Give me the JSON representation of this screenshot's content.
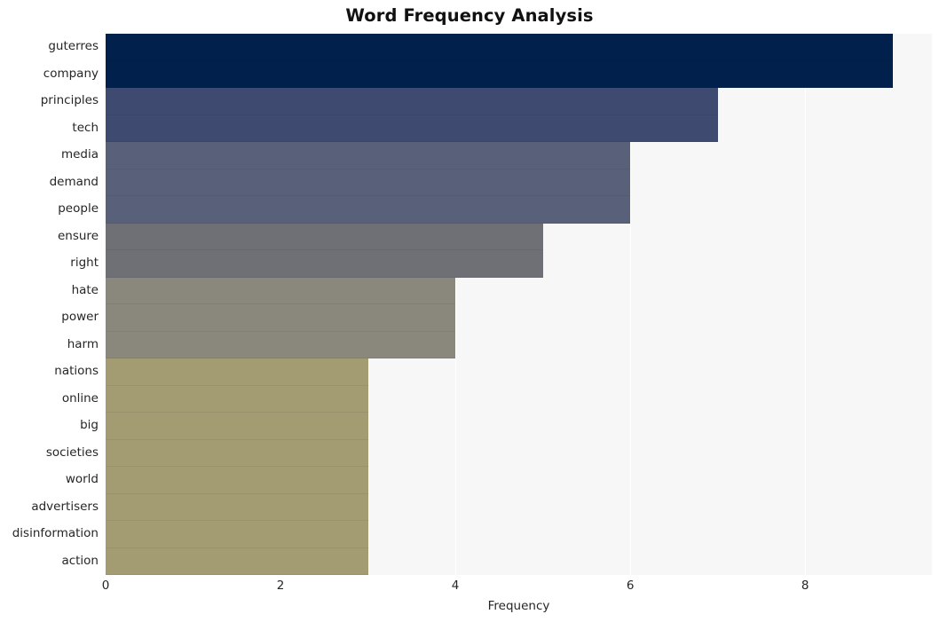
{
  "chart_data": {
    "type": "bar",
    "orientation": "horizontal",
    "title": "Word Frequency Analysis",
    "xlabel": "Frequency",
    "ylabel": "",
    "categories": [
      "guterres",
      "company",
      "principles",
      "tech",
      "media",
      "demand",
      "people",
      "ensure",
      "right",
      "hate",
      "power",
      "harm",
      "nations",
      "online",
      "big",
      "societies",
      "world",
      "advertisers",
      "disinformation",
      "action"
    ],
    "values": [
      9,
      9,
      7,
      7,
      6,
      6,
      6,
      5,
      5,
      4,
      4,
      4,
      3,
      3,
      3,
      3,
      3,
      3,
      3,
      3
    ],
    "bar_colors": [
      "#02204c",
      "#02204c",
      "#3e4a70",
      "#3e4a70",
      "#59607a",
      "#59607a",
      "#59607a",
      "#6e7075",
      "#6e7075",
      "#8a887c",
      "#8a887c",
      "#8a887c",
      "#a39c73",
      "#a39c73",
      "#a39c73",
      "#a39c73",
      "#a39c73",
      "#a39c73",
      "#a39c73",
      "#a39c73"
    ],
    "xlim": [
      0,
      9.45
    ],
    "xticks": [
      0,
      2,
      4,
      6,
      8
    ],
    "xtick_labels": [
      "0",
      "2",
      "4",
      "6",
      "8"
    ],
    "grid": true,
    "grid_axis": "x",
    "grid_color": "#ffffff",
    "plot_background": "#f7f7f7",
    "figure_background": "#ffffff",
    "legend": null
  }
}
